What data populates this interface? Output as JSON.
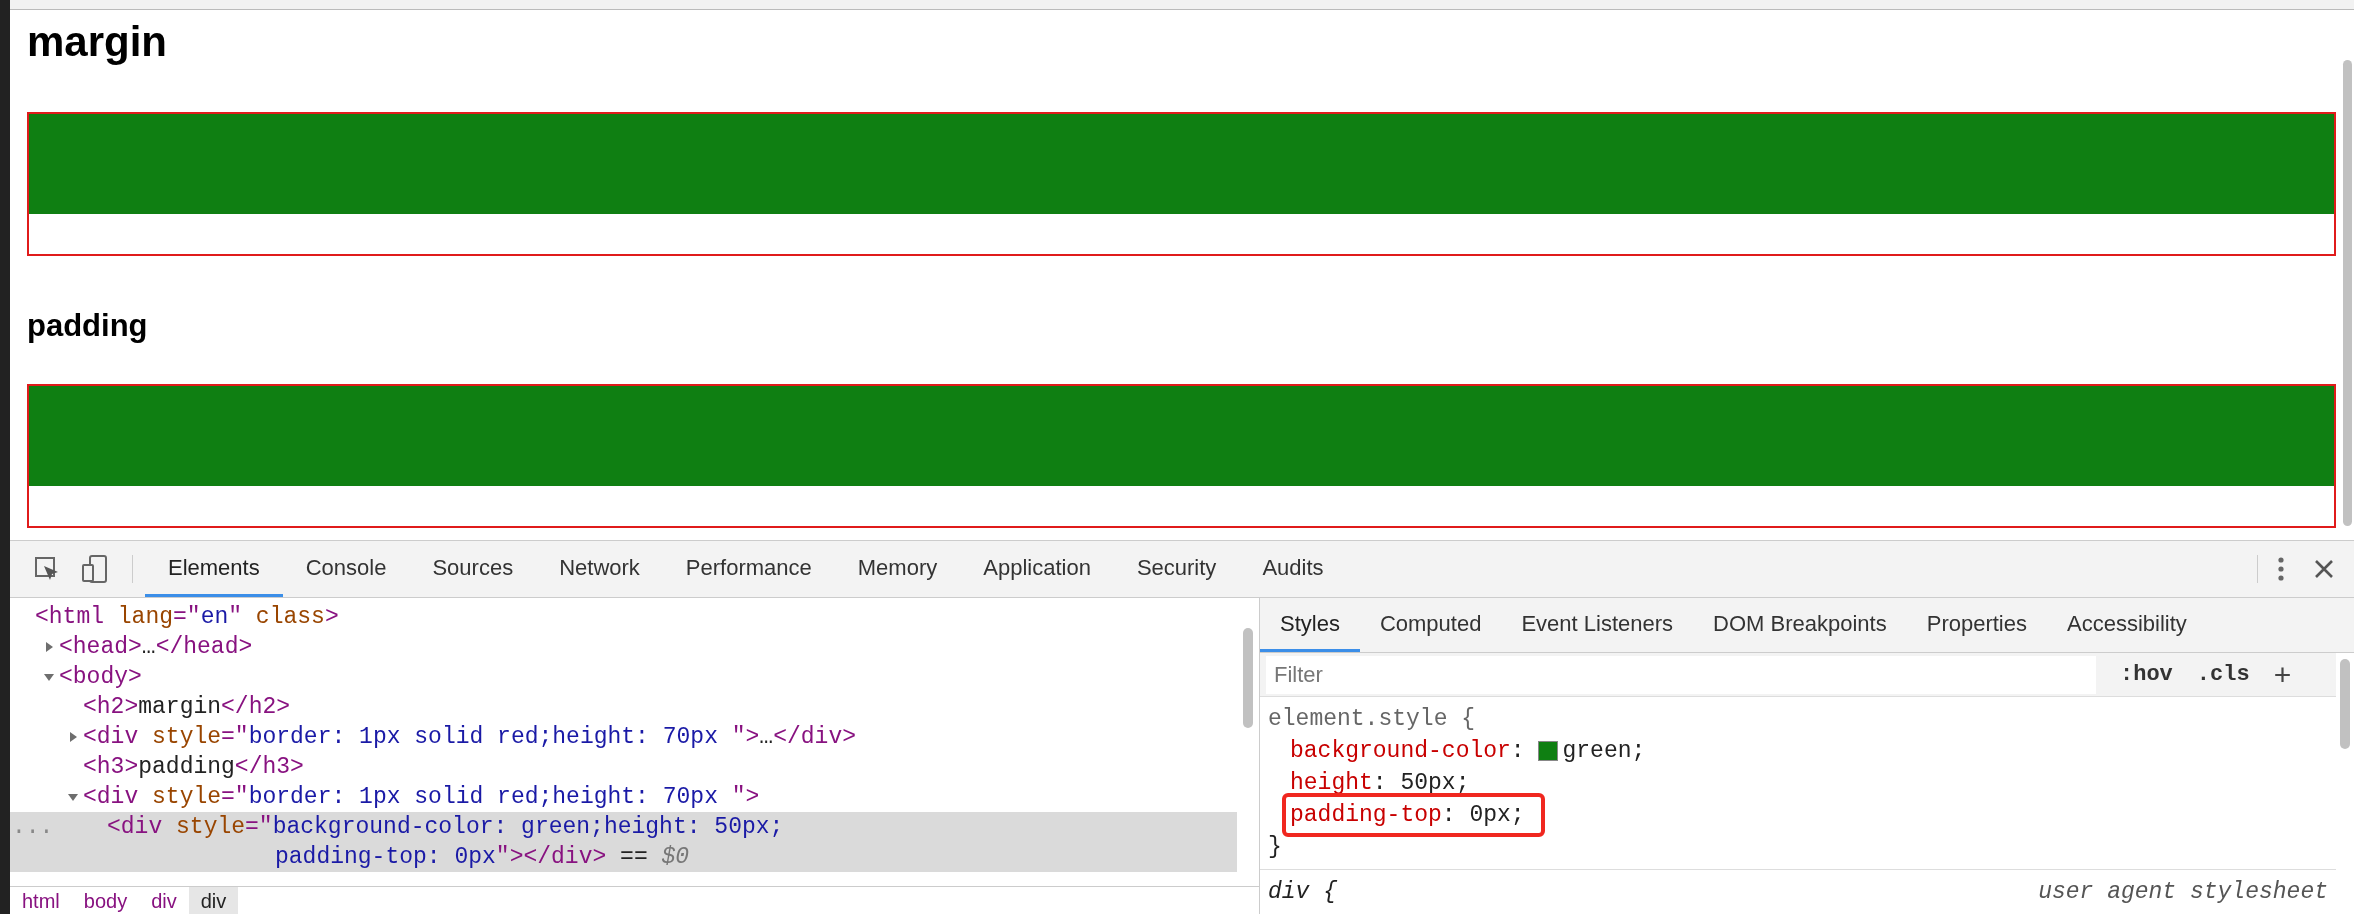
{
  "page": {
    "sections": [
      {
        "heading": "margin",
        "kind": "h2"
      },
      {
        "heading": "padding",
        "kind": "h3"
      }
    ]
  },
  "devtools": {
    "tabs": [
      {
        "label": "Elements",
        "selected": true
      },
      {
        "label": "Console",
        "selected": false
      },
      {
        "label": "Sources",
        "selected": false
      },
      {
        "label": "Network",
        "selected": false
      },
      {
        "label": "Performance",
        "selected": false
      },
      {
        "label": "Memory",
        "selected": false
      },
      {
        "label": "Application",
        "selected": false
      },
      {
        "label": "Security",
        "selected": false
      },
      {
        "label": "Audits",
        "selected": false
      }
    ],
    "tree": [
      {
        "selected": false,
        "lines": [
          [
            {
              "kind": "tag",
              "text": "<html"
            },
            {
              "kind": "attr",
              "text": " lang"
            },
            {
              "kind": "tag",
              "text": "=\""
            },
            {
              "kind": "value",
              "text": "en"
            },
            {
              "kind": "tag",
              "text": "\""
            },
            {
              "kind": "attr",
              "text": " class"
            },
            {
              "kind": "tag",
              "text": ">"
            }
          ]
        ],
        "children": [
          {
            "selected": false,
            "expanded": false,
            "lines": [
              [
                {
                  "kind": "tag",
                  "text": "<head>"
                },
                {
                  "kind": "text",
                  "text": "…"
                },
                {
                  "kind": "tag",
                  "text": "</head>"
                }
              ]
            ]
          },
          {
            "selected": false,
            "expanded": true,
            "lines": [
              [
                {
                  "kind": "tag",
                  "text": "<body>"
                }
              ]
            ],
            "children": [
              {
                "selected": false,
                "lines": [
                  [
                    {
                      "kind": "tag",
                      "text": "<h2>"
                    },
                    {
                      "kind": "text",
                      "text": "margin"
                    },
                    {
                      "kind": "tag",
                      "text": "</h2>"
                    }
                  ]
                ]
              },
              {
                "selected": false,
                "expanded": false,
                "lines": [
                  [
                    {
                      "kind": "tag",
                      "text": "<div"
                    },
                    {
                      "kind": "attr",
                      "text": " style"
                    },
                    {
                      "kind": "tag",
                      "text": "=\""
                    },
                    {
                      "kind": "value",
                      "text": "border: 1px solid red;height: 70px "
                    },
                    {
                      "kind": "tag",
                      "text": "\">"
                    },
                    {
                      "kind": "text",
                      "text": "…"
                    },
                    {
                      "kind": "tag",
                      "text": "</div>"
                    }
                  ]
                ]
              },
              {
                "selected": false,
                "lines": [
                  [
                    {
                      "kind": "tag",
                      "text": "<h3>"
                    },
                    {
                      "kind": "text",
                      "text": "padding"
                    },
                    {
                      "kind": "tag",
                      "text": "</h3>"
                    }
                  ]
                ]
              },
              {
                "selected": false,
                "expanded": true,
                "lines": [
                  [
                    {
                      "kind": "tag",
                      "text": "<div"
                    },
                    {
                      "kind": "attr",
                      "text": " style"
                    },
                    {
                      "kind": "tag",
                      "text": "=\""
                    },
                    {
                      "kind": "value",
                      "text": "border: 1px solid red;height: 70px "
                    },
                    {
                      "kind": "tag",
                      "text": "\">"
                    }
                  ]
                ],
                "children": [
                  {
                    "selected": true,
                    "lines": [
                      [
                        {
                          "kind": "tag",
                          "text": "<div"
                        },
                        {
                          "kind": "attr",
                          "text": " style"
                        },
                        {
                          "kind": "tag",
                          "text": "=\""
                        },
                        {
                          "kind": "value",
                          "text": "background-color: green;height: 50px;"
                        }
                      ],
                      [
                        {
                          "kind": "value",
                          "text": "padding-top: 0px"
                        },
                        {
                          "kind": "tag",
                          "text": "\">"
                        },
                        {
                          "kind": "tag",
                          "text": "</div>"
                        },
                        {
                          "kind": "text",
                          "text": " == "
                        },
                        {
                          "kind": "ref",
                          "text": "$0"
                        }
                      ]
                    ]
                  }
                ]
              }
            ]
          }
        ]
      }
    ],
    "selection_marker": "...",
    "breadcrumbs": [
      {
        "label": "html",
        "selected": false
      },
      {
        "label": "body",
        "selected": false
      },
      {
        "label": "div",
        "selected": false
      },
      {
        "label": "div",
        "selected": true
      }
    ],
    "sidebar_tabs": [
      {
        "label": "Styles",
        "selected": true
      },
      {
        "label": "Computed",
        "selected": false
      },
      {
        "label": "Event Listeners",
        "selected": false
      },
      {
        "label": "DOM Breakpoints",
        "selected": false
      },
      {
        "label": "Properties",
        "selected": false
      },
      {
        "label": "Accessibility",
        "selected": false
      }
    ],
    "filter": {
      "placeholder": "Filter",
      "hov": ":hov",
      "cls": ".cls",
      "add": "+"
    },
    "rules": [
      {
        "kind": "inline",
        "selector": "element.style {",
        "close": "}",
        "properties": [
          {
            "name": "background-color",
            "separator": ":",
            "value": "green;",
            "color": "#0f7f12",
            "highlighted": false
          },
          {
            "name": "height",
            "separator": ":",
            "value": "50px;",
            "highlighted": false
          },
          {
            "name": "padding-top",
            "separator": ":",
            "value": "0px;",
            "highlighted": true
          }
        ]
      },
      {
        "kind": "useragent",
        "selector": "div {",
        "source": "user agent stylesheet"
      }
    ]
  }
}
